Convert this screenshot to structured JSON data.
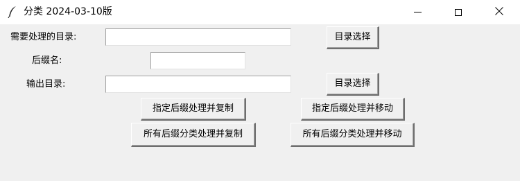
{
  "window": {
    "title": "分类 2024-03-10版",
    "icon": "feather-icon",
    "controls": [
      "minimize-icon",
      "maximize-icon",
      "close-icon"
    ]
  },
  "form": {
    "source_dir_label": "需要处理的目录:",
    "source_dir_value": "",
    "select_source_button": "目录选择",
    "suffix_label": "后缀名:",
    "suffix_value": "",
    "output_dir_label": "输出目录:",
    "output_dir_value": "",
    "select_output_button": "目录选择"
  },
  "actions": {
    "suffix_copy": "指定后缀处理并复制",
    "suffix_move": "指定后缀处理并移动",
    "all_copy": "所有后缀分类处理并复制",
    "all_move": "所有后缀分类处理并移动"
  }
}
